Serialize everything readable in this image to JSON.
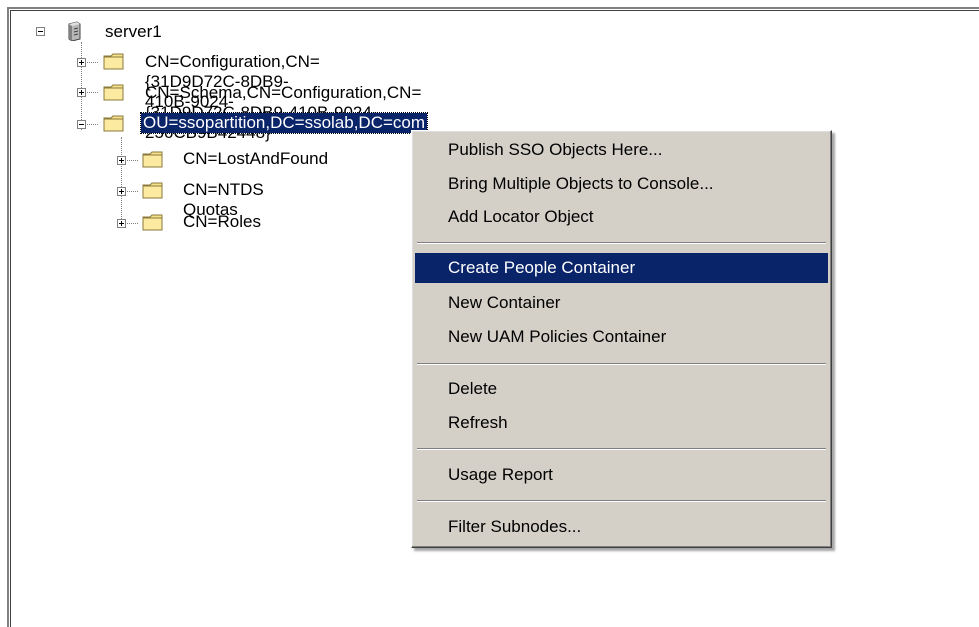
{
  "tree": {
    "root": {
      "label": "server1",
      "icon": "server-icon",
      "expanded": true
    },
    "children": [
      {
        "label": "CN=Configuration,CN={31D9D72C-8DB9-410B-9024-256CB9B42448}",
        "icon": "folder-icon",
        "expanded": false
      },
      {
        "label": "CN=Schema,CN=Configuration,CN={31D9D72C-8DB9-410B-9024-256CB9B42448}",
        "icon": "folder-icon",
        "expanded": false
      },
      {
        "label": "OU=ssopartition,DC=ssolab,DC=com",
        "icon": "folder-icon",
        "expanded": true,
        "selected": true,
        "children": [
          {
            "label": "CN=LostAndFound",
            "icon": "folder-icon",
            "expanded": false
          },
          {
            "label": "CN=NTDS Quotas",
            "icon": "folder-icon",
            "expanded": false
          },
          {
            "label": "CN=Roles",
            "icon": "folder-icon",
            "expanded": false
          }
        ]
      }
    ]
  },
  "context_menu": {
    "groups": [
      [
        "Publish SSO Objects Here...",
        "Bring Multiple Objects to Console...",
        "Add Locator Object"
      ],
      [
        "Create People Container",
        "New Container",
        "New UAM Policies Container"
      ],
      [
        "Delete",
        "Refresh"
      ],
      [
        "Usage Report"
      ],
      [
        "Filter Subnodes..."
      ]
    ],
    "highlighted": "Create People Container"
  },
  "colors": {
    "selection": "#0a246a",
    "menu_bg": "#d4d0c8",
    "folder": "#f5e08c"
  }
}
